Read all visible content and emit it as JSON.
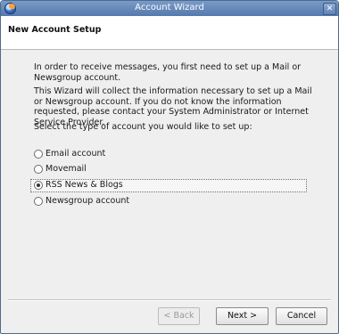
{
  "window": {
    "title": "Account Wizard"
  },
  "header": {
    "title": "New Account Setup"
  },
  "content": {
    "paragraphs": [
      "In order to receive messages, you first need to set up a Mail or Newsgroup account.",
      "This Wizard will collect the information necessary to set up a Mail or Newsgroup account. If you do not know the information requested, please contact your System Administrator or Internet Service Provider.",
      "Select the type of account you would like to set up:"
    ],
    "options": [
      {
        "label": "Email account",
        "selected": false
      },
      {
        "label": "Movemail",
        "selected": false
      },
      {
        "label": "RSS News & Blogs",
        "selected": true
      },
      {
        "label": "Newsgroup account",
        "selected": false
      }
    ]
  },
  "buttons": {
    "back": "< Back",
    "next": "Next >",
    "cancel": "Cancel"
  },
  "icons": {
    "app": "mail-wizard-icon",
    "close": "close-icon"
  },
  "colors": {
    "titlebar": "#5479ae",
    "dialog_bg": "#efefef"
  }
}
